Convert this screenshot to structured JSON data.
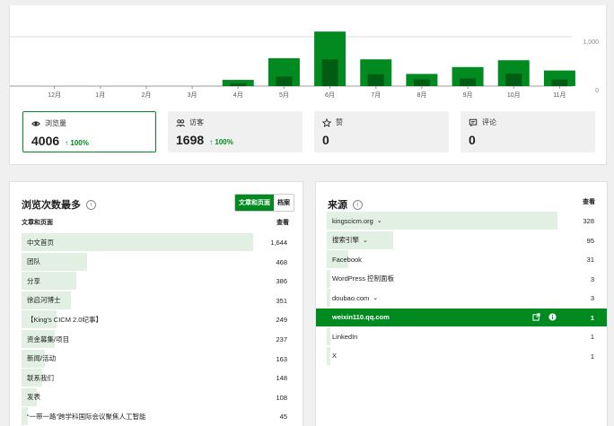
{
  "chart": {
    "months": [
      "12月",
      "1月",
      "2月",
      "3月",
      "4月",
      "5月",
      "6月",
      "7月",
      "8月",
      "9月",
      "10月",
      "11月"
    ],
    "total": [
      0,
      0,
      0,
      0,
      54,
      243,
      475,
      233,
      106,
      166,
      225,
      136
    ],
    "inner": [
      0,
      0,
      0,
      0,
      24,
      83,
      232,
      103,
      58,
      66,
      109,
      57
    ],
    "ymax": 500,
    "tick_labels": [
      "1,000",
      "0"
    ],
    "colors": {
      "total": "#008a20",
      "inner": "#005c12",
      "grid": "#dcdcdc"
    }
  },
  "stats": [
    {
      "label": "浏览量",
      "value": "4006",
      "delta": "↑ 100%",
      "icon": "eye-icon"
    },
    {
      "label": "访客",
      "value": "1698",
      "delta": "↑ 100%",
      "icon": "people-icon"
    },
    {
      "label": "赞",
      "value": "0",
      "delta": "",
      "icon": "star-icon"
    },
    {
      "label": "评论",
      "value": "0",
      "delta": "",
      "icon": "comment-icon"
    }
  ],
  "left": {
    "title": "浏览次数最多",
    "seg": [
      "文章和页面",
      "档案"
    ],
    "col_left": "文章和页面",
    "col_right": "查看",
    "rows": [
      {
        "label": "中文首页",
        "value": "1,644",
        "n": 1644
      },
      {
        "label": "团队",
        "value": "468",
        "n": 468
      },
      {
        "label": "分享",
        "value": "386",
        "n": 386
      },
      {
        "label": "徐启河博士",
        "value": "351",
        "n": 351
      },
      {
        "label": "【King's CICM 2.0纪事】",
        "value": "249",
        "n": 249
      },
      {
        "label": "资金募集/项目",
        "value": "237",
        "n": 237
      },
      {
        "label": "新闻/活动",
        "value": "163",
        "n": 163
      },
      {
        "label": "联系我们",
        "value": "148",
        "n": 148
      },
      {
        "label": "发表",
        "value": "108",
        "n": 108
      },
      {
        "label": "“一带一路”跨学科国际会议聚焦人工智能",
        "value": "45",
        "n": 45
      }
    ]
  },
  "right": {
    "title": "来源",
    "col_right": "查看",
    "rows": [
      {
        "label": "kingscicm.org",
        "value": "328",
        "n": 328,
        "chev": true
      },
      {
        "label": "搜索引擎",
        "value": "95",
        "n": 95,
        "chev": true
      },
      {
        "label": "Facebook",
        "value": "31",
        "n": 31
      },
      {
        "label": "WordPress 控制面板",
        "value": "3",
        "n": 3
      },
      {
        "label": "doubao.com",
        "value": "3",
        "n": 3,
        "chev": true
      },
      {
        "label": "weixin110.qq.com",
        "value": "1",
        "n": 1,
        "selected": true
      },
      {
        "label": "LinkedIn",
        "value": "1",
        "n": 1
      },
      {
        "label": "X",
        "value": "1",
        "n": 1
      }
    ]
  }
}
